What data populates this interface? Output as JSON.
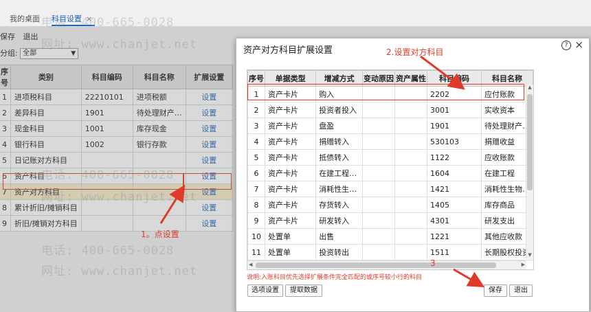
{
  "tabs": [
    {
      "label": "我的桌面"
    },
    {
      "label": "科目设置",
      "close": "×"
    }
  ],
  "toolbar": {
    "save": "保存",
    "exit": "退出"
  },
  "filter": {
    "label": "分组:",
    "value": "全部"
  },
  "bg_table": {
    "headers": [
      "序号",
      "类别",
      "科目编码",
      "科目名称",
      "扩展设置"
    ],
    "rows": [
      [
        "1",
        "进项税科目",
        "22210101",
        "进项税额",
        "设置"
      ],
      [
        "2",
        "差异科目",
        "1901",
        "待处理财产…",
        "设置"
      ],
      [
        "3",
        "现金科目",
        "1001",
        "库存现金",
        "设置"
      ],
      [
        "4",
        "银行科目",
        "1002",
        "银行存款",
        "设置"
      ],
      [
        "5",
        "日记账对方科目",
        "",
        "",
        "设置"
      ],
      [
        "6",
        "资产科目",
        "",
        "",
        "设置"
      ],
      [
        "7",
        "资产对方科目",
        "",
        "",
        "设置"
      ],
      [
        "8",
        "累计折旧/摊销科目",
        "",
        "",
        "设置"
      ],
      [
        "9",
        "折旧/摊销对方科目",
        "",
        "",
        "设置"
      ]
    ]
  },
  "annotations": {
    "step1": "1。点设置",
    "step2": "2.设置对方科目",
    "step3": "3"
  },
  "watermark": {
    "phone": "电话: 400-665-0028",
    "site": "网址: www.chanjet.net"
  },
  "dialog": {
    "title": "资产对方科目扩展设置",
    "help": "?",
    "close": "×",
    "headers": [
      "序号",
      "单据类型",
      "增减方式",
      "变动原因",
      "资产属性",
      "科目编码",
      "科目名称"
    ],
    "rows": [
      [
        "1",
        "资产卡片",
        "购入",
        "",
        "",
        "2202",
        "应付账款"
      ],
      [
        "2",
        "资产卡片",
        "投资者投入",
        "",
        "",
        "3001",
        "实收资本"
      ],
      [
        "3",
        "资产卡片",
        "盘盈",
        "",
        "",
        "1901",
        "待处理财产…"
      ],
      [
        "4",
        "资产卡片",
        "捐赠转入",
        "",
        "",
        "530103",
        "捐赠收益"
      ],
      [
        "5",
        "资产卡片",
        "抵债转入",
        "",
        "",
        "1122",
        "应收账款"
      ],
      [
        "6",
        "资产卡片",
        "在建工程…",
        "",
        "",
        "1604",
        "在建工程"
      ],
      [
        "7",
        "资产卡片",
        "消耗性生…",
        "",
        "",
        "1421",
        "消耗性生物…"
      ],
      [
        "8",
        "资产卡片",
        "存货转入",
        "",
        "",
        "1405",
        "库存商品"
      ],
      [
        "9",
        "资产卡片",
        "研发转入",
        "",
        "",
        "4301",
        "研发支出"
      ],
      [
        "10",
        "处置单",
        "出售",
        "",
        "",
        "1221",
        "其他应收款"
      ],
      [
        "11",
        "处置单",
        "投资转出",
        "",
        "",
        "1511",
        "长期股权投资"
      ]
    ],
    "note": "说明:入账科目优先选择扩展条件完全匹配的或序号较小行的科目",
    "buttons": {
      "options": "选项设置",
      "fetch": "提取数据",
      "save": "保存",
      "exit": "退出"
    }
  }
}
